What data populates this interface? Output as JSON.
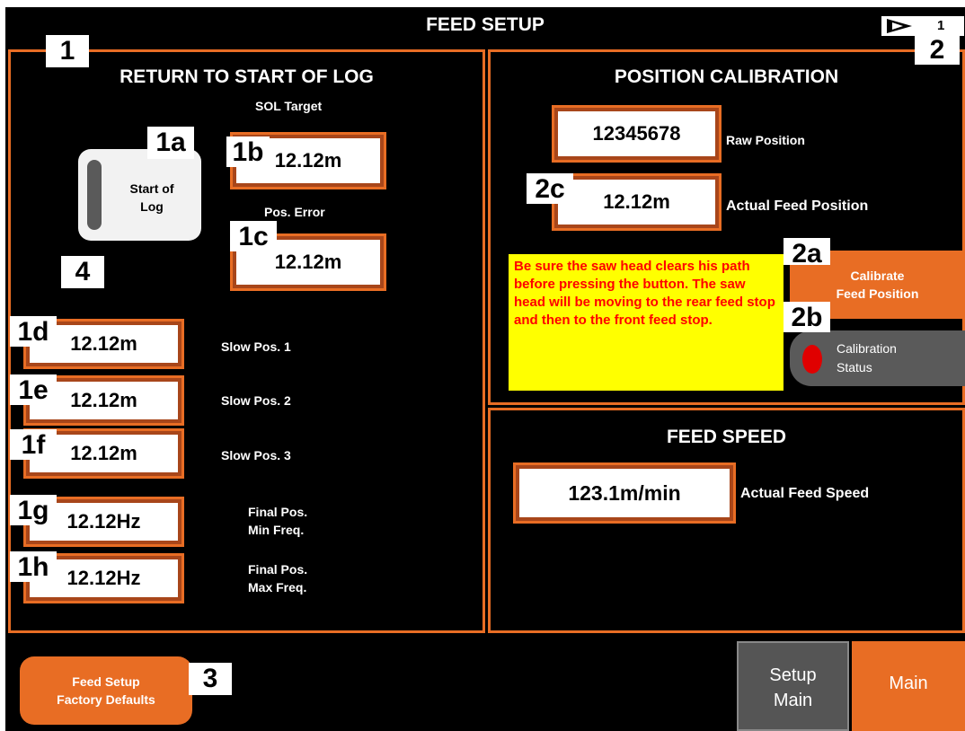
{
  "header": {
    "title": "FEED SETUP",
    "page_arrow_icon": "play-arrow-icon",
    "page_number": "1"
  },
  "callouts": {
    "c1": "1",
    "c1a": "1a",
    "c1b": "1b",
    "c1c": "1c",
    "c1d": "1d",
    "c1e": "1e",
    "c1f": "1f",
    "c1g": "1g",
    "c1h": "1h",
    "c2": "2",
    "c2a": "2a",
    "c2b": "2b",
    "c2c": "2c",
    "c3": "3",
    "c4": "4"
  },
  "return_panel": {
    "title": "RETURN TO START OF LOG",
    "start_button": "Start of\nLog",
    "sol_target_label": "SOL Target",
    "sol_target_value": "12.12m",
    "pos_error_label": "Pos. Error",
    "pos_error_value": "12.12m",
    "rows": [
      {
        "value": "12.12m",
        "label": "Slow Pos. 1"
      },
      {
        "value": "12.12m",
        "label": "Slow Pos. 2"
      },
      {
        "value": "12.12m",
        "label": "Slow Pos. 3"
      },
      {
        "value": "12.12Hz",
        "label": "Final Pos.\nMin Freq."
      },
      {
        "value": "12.12Hz",
        "label": "Final Pos.\nMax Freq."
      }
    ]
  },
  "position_panel": {
    "title": "POSITION CALIBRATION",
    "raw_value": "12345678",
    "raw_label": "Raw Position",
    "actual_value": "12.12m",
    "actual_label": "Actual Feed Position",
    "warning": "Be sure the saw head clears his path before pressing the button. The saw head will be moving to the rear feed stop and then to the front feed stop.",
    "calibrate_button": "Calibrate\nFeed Position",
    "status_label": "Calibration\nStatus",
    "status_color": "#e00000"
  },
  "speed_panel": {
    "title": "FEED SPEED",
    "value": "123.1m/min",
    "label": "Actual Feed Speed"
  },
  "footer": {
    "defaults_button": "Feed Setup\nFactory Defaults",
    "setup_main_button": "Setup\nMain",
    "main_button": "Main"
  }
}
